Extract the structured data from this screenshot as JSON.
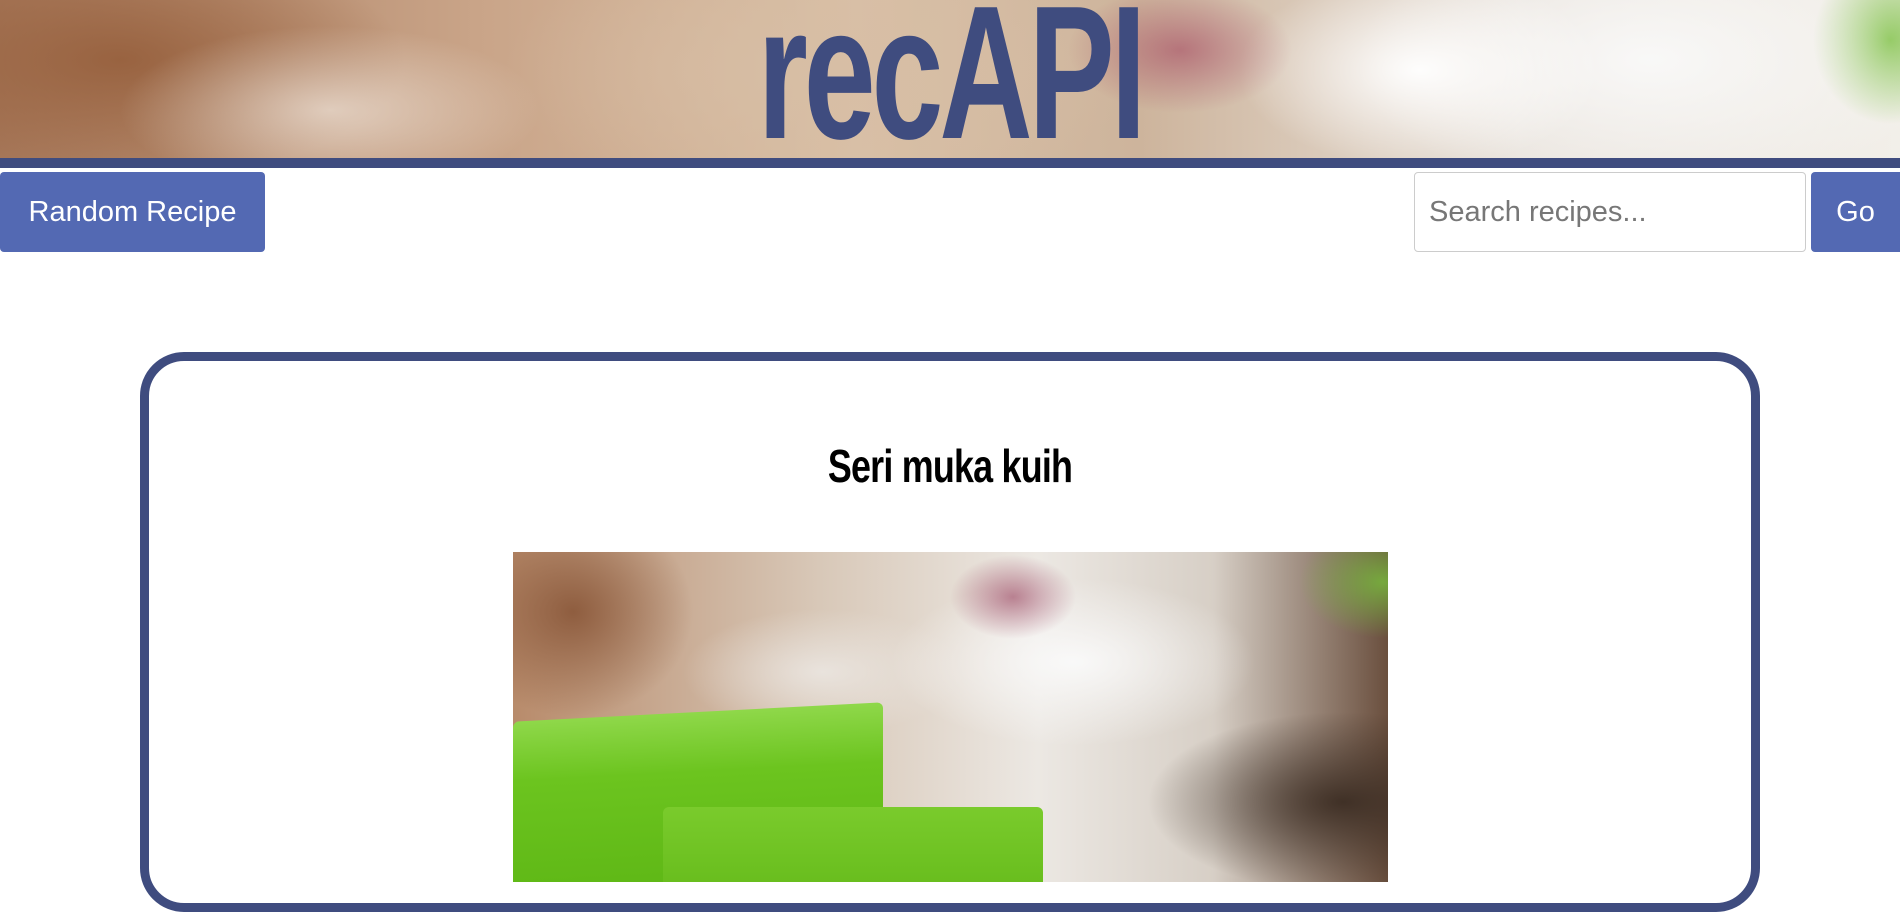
{
  "header": {
    "logo_text": "recAPI"
  },
  "nav": {
    "random_button_label": "Random Recipe",
    "search": {
      "placeholder": "Search recipes...",
      "value": ""
    },
    "go_button_label": "Go"
  },
  "recipe": {
    "title": "Seri muka kuih",
    "image_alt": "Seri muka kuih"
  },
  "colors": {
    "brand_navy": "#3f4c7f",
    "button_blue": "#5369b3"
  }
}
